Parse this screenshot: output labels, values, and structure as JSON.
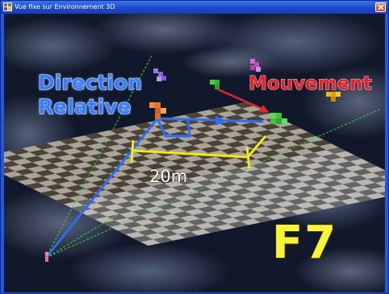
{
  "window": {
    "title": "Vue fixe sur Environnement 3D",
    "close_icon": "close-icon"
  },
  "scene": {
    "label_direction_line1": "Direction",
    "label_direction_line2": "Relative",
    "label_movement": "Mouvement",
    "label_distance": "20m",
    "label_key": "F7"
  },
  "colors": {
    "direction": "#3a7cff",
    "movement": "#e0232e",
    "measure": "#f2e81c",
    "key": "#fbf23c",
    "grid_guide": "#3ecf3e"
  }
}
